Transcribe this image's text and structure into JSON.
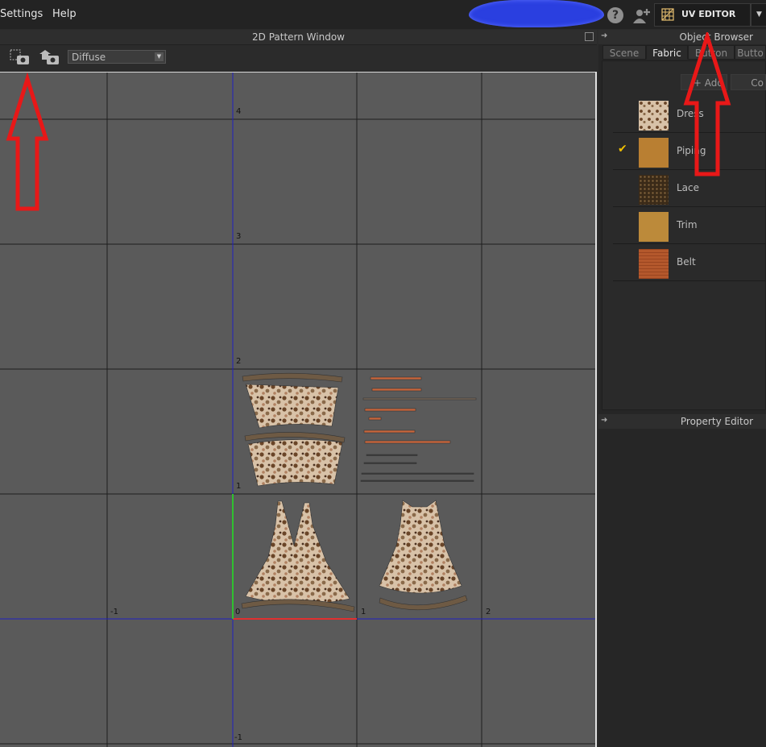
{
  "menubar": {
    "items": [
      "Settings",
      "Help"
    ],
    "help_icon": "question-icon",
    "avatar_icon": "avatar-add-icon",
    "mode_button": {
      "label": "UV EDITOR",
      "icon": "uv-grid-icon"
    }
  },
  "pattern_window": {
    "title": "2D Pattern Window",
    "toolbar": {
      "snapshot_icon": "uv-snapshot-icon",
      "camera_icon": "camera-icon",
      "map_select": "Diffuse"
    },
    "axis_labels": {
      "y4": "4",
      "y3": "3",
      "y2": "2",
      "y1": "1",
      "y0": "0",
      "ym1": "-1",
      "xm1": "-1",
      "x1": "1",
      "x2": "2"
    }
  },
  "object_browser": {
    "title": "Object Browser",
    "tabs": [
      "Scene",
      "Fabric",
      "Button",
      "Butto"
    ],
    "active_tab": "Fabric",
    "buttons": {
      "add": "+ Add",
      "copy": "Co"
    },
    "fabrics": [
      {
        "name": "Dress",
        "color": "#b08a6a",
        "checked": false
      },
      {
        "name": "Piping",
        "color": "#b97f32",
        "checked": true
      },
      {
        "name": "Lace",
        "color": "#5a3e22",
        "checked": false
      },
      {
        "name": "Trim",
        "color": "#bc8a3a",
        "checked": false
      },
      {
        "name": "Belt",
        "color": "#b4582c",
        "checked": false
      }
    ]
  },
  "property_editor": {
    "title": "Property Editor"
  },
  "colors": {
    "accent_check": "#f0c000",
    "annotation_arrow": "#e81818",
    "redaction": "#2a3fe0",
    "v_axis": "#2020c0",
    "u_axis_highlight": "#e03030",
    "v_axis_highlight": "#30c030"
  }
}
